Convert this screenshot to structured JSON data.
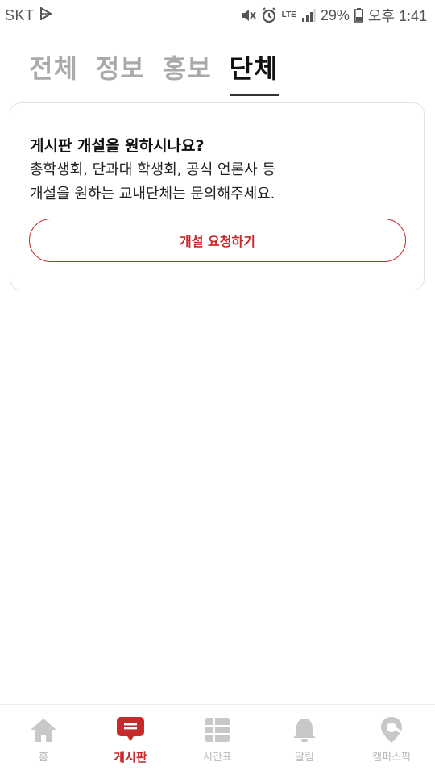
{
  "status_bar": {
    "carrier": "SKT",
    "network": "LTE",
    "battery": "29%",
    "time": "오후 1:41"
  },
  "tabs": [
    {
      "label": "전체",
      "active": false
    },
    {
      "label": "정보",
      "active": false
    },
    {
      "label": "홍보",
      "active": false
    },
    {
      "label": "단체",
      "active": true
    }
  ],
  "card": {
    "title": "게시판 개설을 원하시나요?",
    "desc_line1": "총학생회, 단과대 학생회, 공식 언론사 등",
    "desc_line2": "개설을 원하는 교내단체는 문의해주세요.",
    "button_label": "개설 요청하기"
  },
  "bottom_nav": {
    "items": [
      {
        "label": "홈",
        "icon": "home-icon",
        "active": false
      },
      {
        "label": "게시판",
        "icon": "board-icon",
        "active": true
      },
      {
        "label": "시간표",
        "icon": "timetable-icon",
        "active": false
      },
      {
        "label": "알림",
        "icon": "bell-icon",
        "active": false
      },
      {
        "label": "캠퍼스픽",
        "icon": "campuspick-icon",
        "active": false
      }
    ]
  },
  "colors": {
    "accent": "#c62a2a",
    "inactive": "#c2c2c2"
  }
}
